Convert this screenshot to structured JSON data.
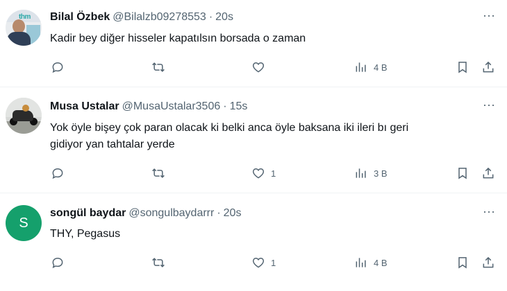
{
  "tweets": [
    {
      "name": "Bilal Özbek",
      "handle": "@Bilalzb09278553",
      "dot": "·",
      "time": "20s",
      "lines": [
        "Kadir bey diğer hisseler kapatılsın borsada o zaman"
      ],
      "likes": "",
      "views": "4 B",
      "avatar_logo": "thm"
    },
    {
      "name": "Musa Ustalar",
      "handle": "@MusaUstalar3506",
      "dot": "·",
      "time": "15s",
      "lines": [
        "Yok öyle bişey çok paran olacak ki belki anca öyle baksana iki ileri bı geri",
        "gidiyor yan tahtalar yerde"
      ],
      "likes": "1",
      "views": "3 B"
    },
    {
      "name": "songül baydar",
      "handle": "@songulbaydarrr",
      "dot": "·",
      "time": "20s",
      "lines": [
        "THY, Pegasus"
      ],
      "likes": "1",
      "views": "4 B",
      "avatar_letter": "S"
    }
  ],
  "more_label": "···",
  "colors": {
    "text": "#0f1419",
    "secondary": "#536471",
    "divider": "#eff3f4",
    "avatar_green": "#15a06c"
  },
  "icons": [
    "reply-icon",
    "retweet-icon",
    "like-icon",
    "views-icon",
    "bookmark-icon",
    "share-icon"
  ]
}
